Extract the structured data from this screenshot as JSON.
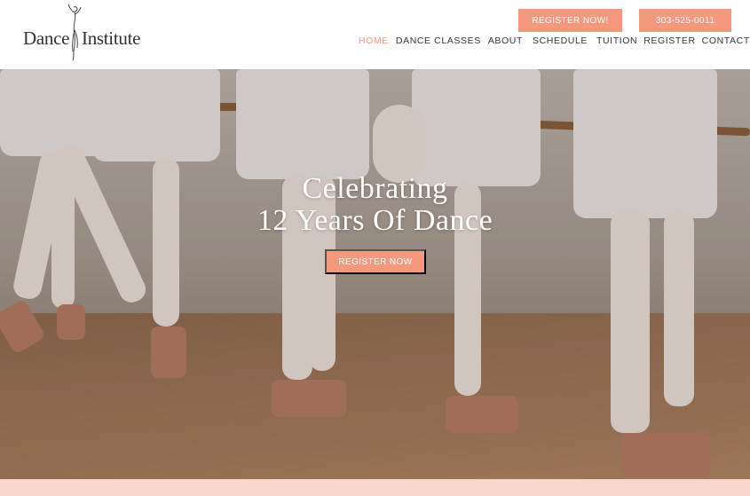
{
  "brand": {
    "name_left": "Dance",
    "name_right": "Institute"
  },
  "header": {
    "register_button": "REGISTER NOW!",
    "phone_button": "303-525-0011",
    "nav": [
      {
        "label": "HOME",
        "active": true
      },
      {
        "label": "DANCE CLASSES",
        "active": false
      },
      {
        "label": "ABOUT",
        "active": false
      },
      {
        "label": "SCHEDULE",
        "active": false
      },
      {
        "label": "TUITION",
        "active": false
      },
      {
        "label": "REGISTER",
        "active": false
      },
      {
        "label": "CONTACT US",
        "active": false
      }
    ]
  },
  "hero": {
    "title_line1": "Celebrating",
    "title_line2": "12 Years Of Dance",
    "button": "REGISTER NOW"
  },
  "colors": {
    "accent": "#f4987e",
    "text": "#333333",
    "band": "#f9d7cc"
  }
}
